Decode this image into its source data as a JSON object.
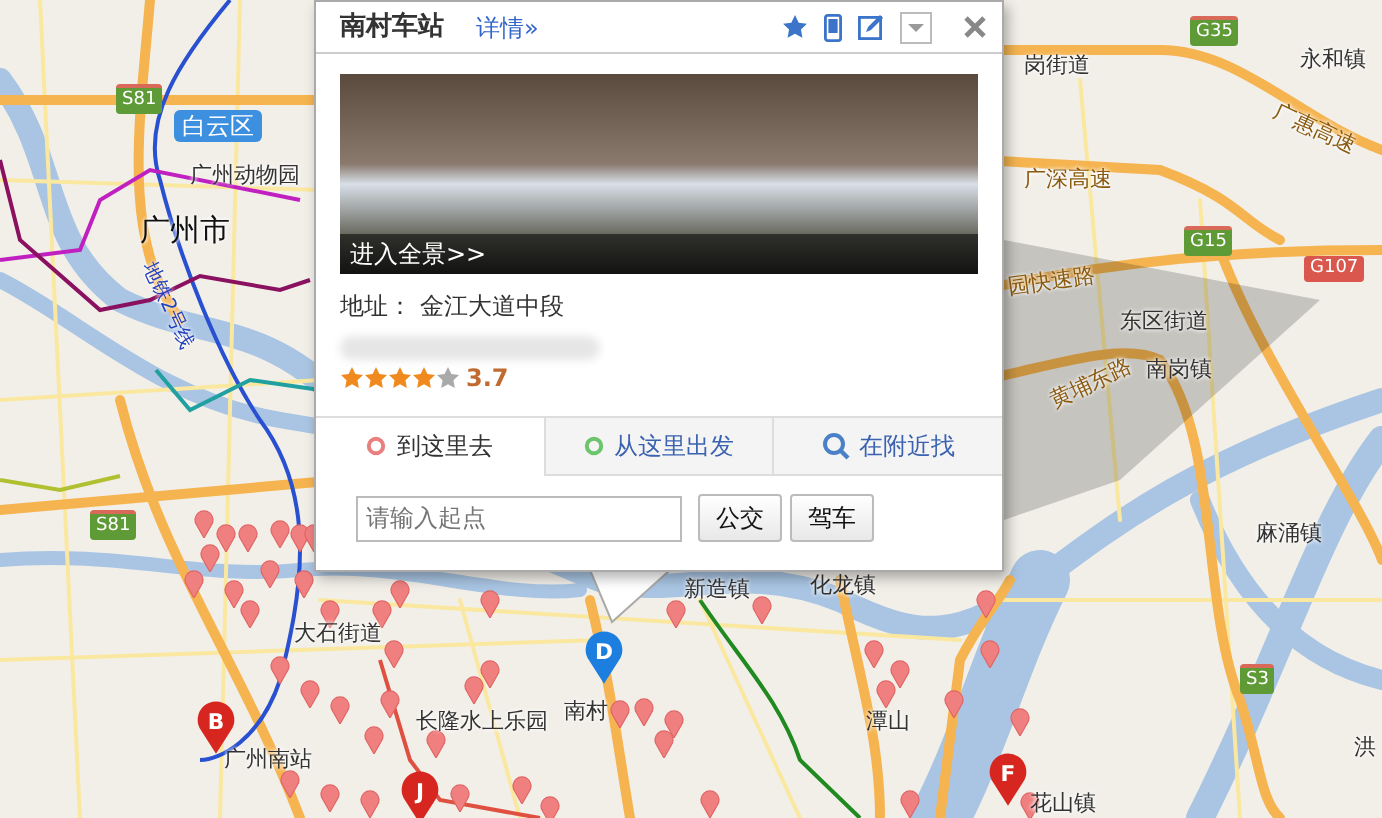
{
  "map": {
    "labels": [
      {
        "text": "白云区",
        "kind": "district"
      },
      {
        "text": "广州动物园",
        "kind": "place"
      },
      {
        "text": "广州市",
        "kind": "city"
      },
      {
        "text": "地铁2号线",
        "kind": "metro"
      },
      {
        "text": "S81",
        "kind": "shield"
      },
      {
        "text": "S81",
        "kind": "shield"
      },
      {
        "text": "G35",
        "kind": "shield"
      },
      {
        "text": "G15",
        "kind": "shield"
      },
      {
        "text": "G107",
        "kind": "shield-red"
      },
      {
        "text": "S3",
        "kind": "shield"
      },
      {
        "text": "永和镇",
        "kind": "place"
      },
      {
        "text": "广惠高速",
        "kind": "road"
      },
      {
        "text": "岗街道",
        "kind": "place"
      },
      {
        "text": "广深高速",
        "kind": "road"
      },
      {
        "text": "园快速路",
        "kind": "road"
      },
      {
        "text": "东区街道",
        "kind": "place"
      },
      {
        "text": "南岗镇",
        "kind": "place"
      },
      {
        "text": "黄埔东路",
        "kind": "road"
      },
      {
        "text": "麻涌镇",
        "kind": "place"
      },
      {
        "text": "洪",
        "kind": "place"
      },
      {
        "text": "大石街道",
        "kind": "place"
      },
      {
        "text": "广州南站",
        "kind": "place"
      },
      {
        "text": "长隆水上乐园",
        "kind": "place"
      },
      {
        "text": "南村",
        "kind": "place"
      },
      {
        "text": "新造镇",
        "kind": "place"
      },
      {
        "text": "化龙镇",
        "kind": "place"
      },
      {
        "text": "潭山",
        "kind": "place"
      },
      {
        "text": "花山镇",
        "kind": "place"
      }
    ],
    "markers": [
      {
        "letter": "B",
        "color": "#d6261f"
      },
      {
        "letter": "D",
        "color": "#1c7fe0"
      },
      {
        "letter": "J",
        "color": "#d6261f"
      },
      {
        "letter": "F",
        "color": "#d6261f"
      }
    ]
  },
  "popup": {
    "title": "南村车站",
    "details_link": "详情»",
    "photo_caption": "进入全景>>",
    "address_label": "地址：",
    "address": "金江大道中段",
    "stars": 4,
    "rating": "3.7",
    "tabs": [
      {
        "label": "到这里去",
        "selected": true,
        "kind": "to"
      },
      {
        "label": "从这里出发",
        "selected": false,
        "kind": "from"
      },
      {
        "label": "在附近找",
        "selected": false,
        "kind": "nearby"
      }
    ],
    "start_field": {
      "placeholder": "请输入起点"
    },
    "buttons": [
      "公交",
      "驾车"
    ]
  }
}
